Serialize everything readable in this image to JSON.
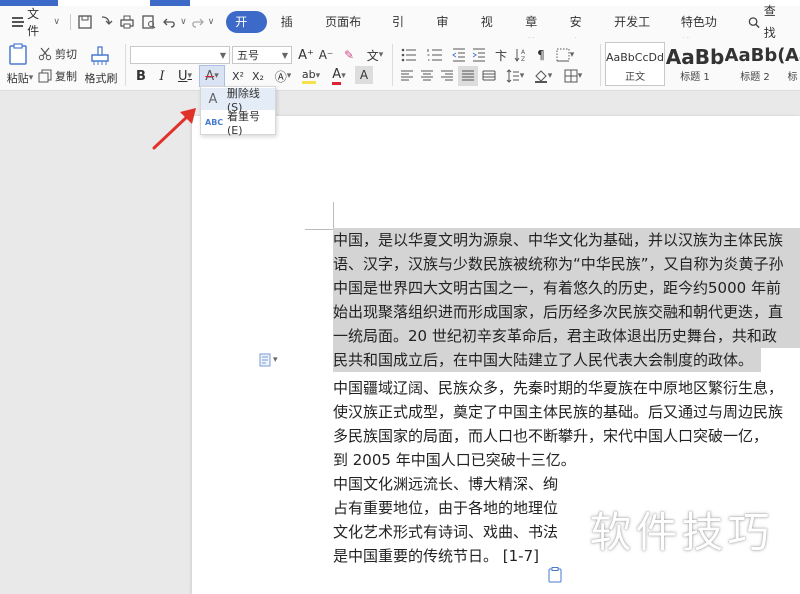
{
  "menubar": {
    "file_label": "文件",
    "tabs": [
      "开始",
      "插入",
      "页面布局",
      "引用",
      "审阅",
      "视图",
      "章节",
      "安全",
      "开发工具",
      "特色功能"
    ],
    "active_tab": "开始",
    "search_label": "查找"
  },
  "ribbon": {
    "paste_label": "粘贴",
    "cut_label": "剪切",
    "copy_label": "复制",
    "format_painter_label": "格式刷",
    "font_name_value": "",
    "font_size_value": "五号",
    "styles": [
      {
        "preview": "AaBbCcDd",
        "name": "正文"
      },
      {
        "preview": "AaBb",
        "name": "标题 1"
      },
      {
        "preview": "AaBb(",
        "name": "标题 2"
      },
      {
        "preview": "Aa",
        "name": "标"
      }
    ]
  },
  "dropdown": {
    "items": [
      {
        "label": "删除线(S)",
        "icon": "strikethrough-icon"
      },
      {
        "label": "着重号(E)",
        "icon": "emphasis-mark-icon"
      }
    ]
  },
  "document": {
    "paragraphs": [
      {
        "selected": true,
        "lines": [
          "中国，是以华夏文明为源泉、中华文化为基础，并以汉族为主体民族",
          "语、汉字，汉族与少数民族被统称为“中华民族”，又自称为炎黄子孙",
          "中国是世界四大文明古国之一，有着悠久的历史，距今约5000 年前",
          "始出现聚落组织进而形成国家，后历经多次民族交融和朝代更迭，直",
          "一统局面。20 世纪初辛亥革命后，君主政体退出历史舞台，共和政",
          "民共和国成立后，在中国大陆建立了人民代表大会制度的政体。"
        ]
      },
      {
        "selected": false,
        "lines": [
          "中国疆域辽阔、民族众多，先秦时期的华夏族在中原地区繁衍生息，",
          "使汉族正式成型，奠定了中国主体民族的基础。后又通过与周边民族",
          "多民族国家的局面，而人口也不断攀升，宋代中国人口突破一亿，",
          "到 2005 年中国人口已突破十三亿。"
        ]
      },
      {
        "selected": false,
        "lines": [
          "中国文化渊远流长、博大精深、绚",
          "占有重要地位，由于各地的地理位",
          "文化艺术形式有诗词、戏曲、书法",
          "是中国重要的传统节日。 [1-7]"
        ]
      }
    ]
  },
  "watermark": "软件技巧",
  "colors": {
    "accent": "#3d6ac9",
    "selection": "#d4d4d4",
    "arrow": "#e0322b"
  }
}
